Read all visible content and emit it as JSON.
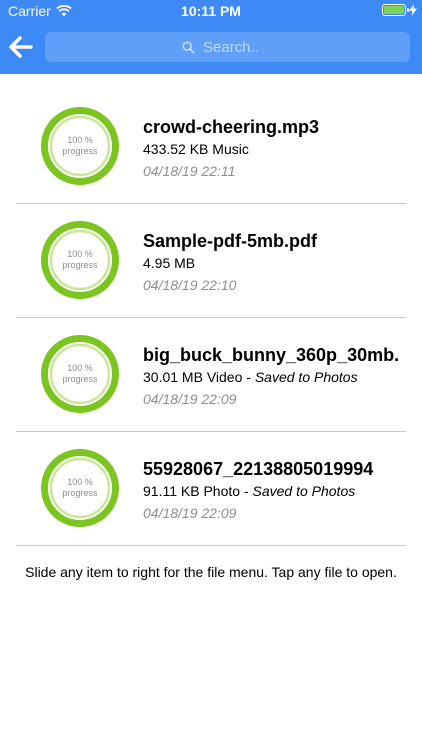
{
  "status_bar": {
    "carrier": "Carrier",
    "time": "10:11 PM"
  },
  "header": {
    "search_placeholder": "Search..",
    "color": "#3d8af7"
  },
  "files": [
    {
      "name": "crowd-cheering.mp3",
      "size": "433.52 KB",
      "type": "Music",
      "saved": "",
      "date": "04/18/19 22:11",
      "progress_text": "100 %",
      "progress_label": "progress",
      "progress": 100
    },
    {
      "name": "Sample-pdf-5mb.pdf",
      "size": "4.95 MB",
      "type": "",
      "saved": "",
      "date": "04/18/19 22:10",
      "progress_text": "100 %",
      "progress_label": "progress",
      "progress": 100
    },
    {
      "name": "big_buck_bunny_360p_30mb.",
      "size": "30.01 MB",
      "type": "Video",
      "saved": "Saved to Photos",
      "date": "04/18/19 22:09",
      "progress_text": "100 %",
      "progress_label": "progress",
      "progress": 100
    },
    {
      "name": "55928067_22138805019994",
      "size": "91.11 KB",
      "type": "Photo",
      "saved": "Saved to Photos",
      "date": "04/18/19 22:09",
      "progress_text": "100 %",
      "progress_label": "progress",
      "progress": 100
    }
  ],
  "hint": "Slide any item to right for the file menu. Tap any file to open.",
  "colors": {
    "ring": "#7cc520",
    "ring_inner": "#c9e79a"
  },
  "icons": {
    "back": "arrow-left-icon",
    "search": "search-icon",
    "wifi": "wifi-icon",
    "battery": "battery-icon",
    "charging": "bolt-icon"
  }
}
